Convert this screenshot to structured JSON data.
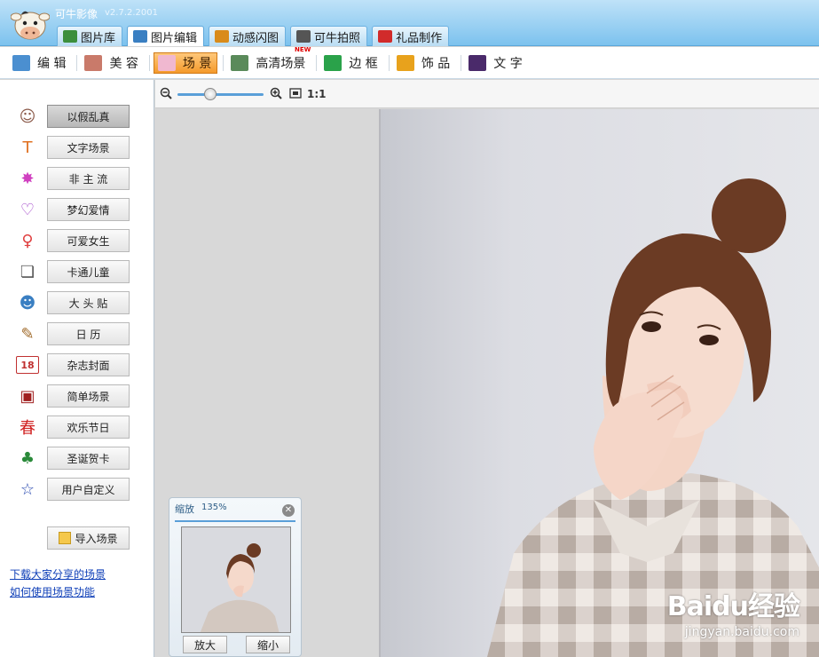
{
  "app": {
    "title": "可牛影像",
    "version": "v2.7.2.2001"
  },
  "tabs": [
    {
      "label": "图片库",
      "active": false,
      "icon": "gallery-icon",
      "color": "#3c8f3c"
    },
    {
      "label": "图片编辑",
      "active": true,
      "icon": "edit-picture-icon",
      "color": "#3a7fc2"
    },
    {
      "label": "动感闪图",
      "active": false,
      "icon": "flash-gif-icon",
      "color": "#d98b1a"
    },
    {
      "label": "可牛拍照",
      "active": false,
      "icon": "webcam-icon",
      "color": "#555555"
    },
    {
      "label": "礼品制作",
      "active": false,
      "icon": "gift-icon",
      "color": "#d12b2b"
    }
  ],
  "toolbar": [
    {
      "label": "编 辑",
      "icon": "edit-icon",
      "color": "#4b8fd0",
      "active": false
    },
    {
      "label": "美 容",
      "icon": "beauty-icon",
      "color": "#c97a6a",
      "active": false
    },
    {
      "label": "场 景",
      "icon": "scene-icon",
      "color": "#f0b8d0",
      "active": true
    },
    {
      "label": "高清场景",
      "icon": "hd-scene-icon",
      "color": "#5a8a5a",
      "active": false,
      "new": true
    },
    {
      "label": "边 框",
      "icon": "frame-icon",
      "color": "#2aa24a",
      "active": false
    },
    {
      "label": "饰 品",
      "icon": "ornament-icon",
      "color": "#e8a21c",
      "active": false
    },
    {
      "label": "文 字",
      "icon": "text-icon",
      "color": "#4a2a6a",
      "active": false
    }
  ],
  "categories": [
    {
      "label": "以假乱真",
      "icon": "face-icon",
      "glyph": "☺",
      "color": "#8b5a4a",
      "active": true
    },
    {
      "label": "文字场景",
      "icon": "text-scene-icon",
      "glyph": "T",
      "color": "#e07020",
      "active": false
    },
    {
      "label": "非 主 流",
      "icon": "sparkle-icon",
      "glyph": "✸",
      "color": "#d040c0",
      "active": false
    },
    {
      "label": "梦幻爱情",
      "icon": "heart-icon",
      "glyph": "♡",
      "color": "#a040c8",
      "active": false
    },
    {
      "label": "可爱女生",
      "icon": "female-icon",
      "glyph": "♀",
      "color": "#e04040",
      "active": false
    },
    {
      "label": "卡通儿童",
      "icon": "cartoon-book-icon",
      "glyph": "❏",
      "color": "#555555",
      "active": false
    },
    {
      "label": "大 头 贴",
      "icon": "photo-sticker-icon",
      "glyph": "☻",
      "color": "#3a7fc2",
      "active": false
    },
    {
      "label": "日 历",
      "icon": "dog-calendar-icon",
      "glyph": "✎",
      "color": "#a06a2a",
      "active": false
    },
    {
      "label": "杂志封面",
      "icon": "calendar-18-icon",
      "glyph": "18",
      "color": "#c03030",
      "active": false
    },
    {
      "label": "简单场景",
      "icon": "simple-frame-icon",
      "glyph": "▣",
      "color": "#a02020",
      "active": false
    },
    {
      "label": "欢乐节日",
      "icon": "spring-festival-icon",
      "glyph": "春",
      "color": "#d02020",
      "active": false
    },
    {
      "label": "圣诞贺卡",
      "icon": "christmas-tree-icon",
      "glyph": "♣",
      "color": "#2a8a3a",
      "active": false
    },
    {
      "label": "用户自定义",
      "icon": "star-icon",
      "glyph": "☆",
      "color": "#2a4ab0",
      "active": false
    }
  ],
  "import_button": "导入场景",
  "links": [
    "下载大家分享的场景",
    "如何使用场景功能"
  ],
  "zoombar": {
    "actual_size": "1:1",
    "slider_level": 0.38
  },
  "navigator": {
    "title": "缩放",
    "zoom": "135%",
    "zoom_in": "放大",
    "zoom_out": "缩小"
  },
  "watermark": {
    "main": "Baidu经验",
    "sub": "jingyan.baidu.com"
  }
}
